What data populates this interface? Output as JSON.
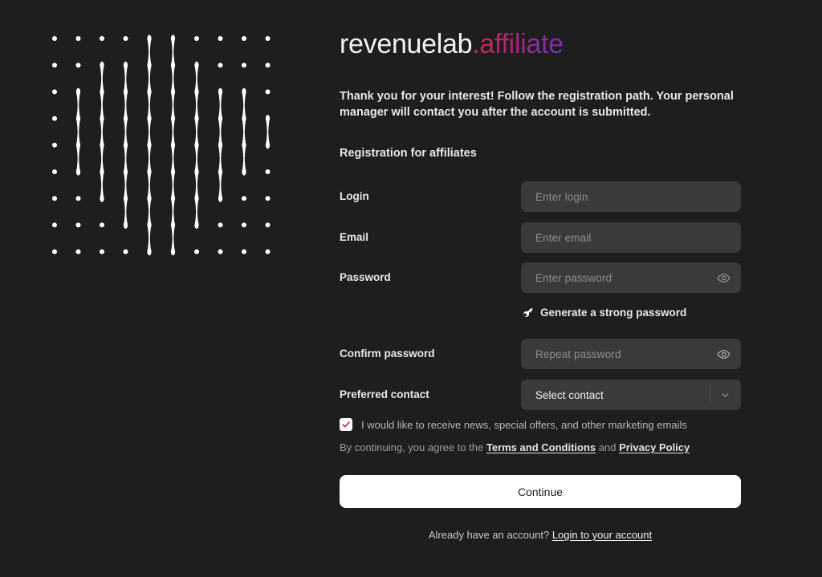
{
  "brand": {
    "name_base": "revenuelab",
    "name_accent": ".affiliate",
    "accent_gradient_from": "#d32b4a",
    "accent_gradient_to": "#7b2fb0"
  },
  "intro": {
    "paragraph": "Thank you for your interest! Follow the registration path. Your personal manager will contact you after the account is submitted.",
    "section_title": "Registration for affiliates"
  },
  "form": {
    "login": {
      "label": "Login",
      "value": "",
      "placeholder": "Enter login"
    },
    "email": {
      "label": "Email",
      "value": "",
      "placeholder": "Enter email"
    },
    "password": {
      "label": "Password",
      "value": "",
      "placeholder": "Enter password"
    },
    "confirm_password": {
      "label": "Confirm password",
      "value": "",
      "placeholder": "Repeat password"
    },
    "preferred_contact": {
      "label": "Preferred contact",
      "selected": "Select contact",
      "options": [
        "Select contact"
      ]
    },
    "generate_password": {
      "label": "Generate a strong password"
    }
  },
  "consent": {
    "marketing_label": "I would like to receive news, special offers, and other marketing emails",
    "marketing_checked": true,
    "checkmark_color": "#d32b4a",
    "terms_prefix": "By continuing, you agree to the",
    "terms_link": "Terms and Conditions",
    "terms_conjunction": "and",
    "privacy_link": "Privacy Policy"
  },
  "actions": {
    "continue_label": "Continue",
    "footer_text": "Already have an account?",
    "footer_link": "Login to your account"
  },
  "decoration": {
    "pattern_name": "dot-grid-bulge",
    "columns": 10,
    "rows": 9,
    "spans": [
      1,
      4,
      6,
      7,
      9,
      9,
      7,
      5,
      4,
      2
    ],
    "dot_color": "#ffffff"
  },
  "theme": {
    "background": "#1e1e1e",
    "input_background": "#3a3a3a",
    "placeholder_color": "#8e8e92",
    "button_background": "#ffffff"
  }
}
